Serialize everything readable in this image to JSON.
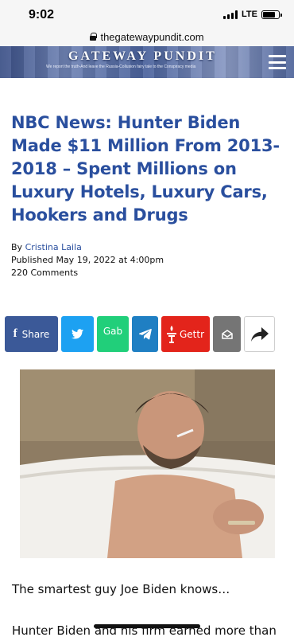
{
  "status_bar": {
    "time": "9:02",
    "network": "LTE"
  },
  "browser": {
    "url": "thegatewaypundit.com"
  },
  "banner": {
    "title": "GATEWAY PUNDIT",
    "tagline": "We report the truth-And leave the Russia-Collusion fairy tale to the Conspiracy media"
  },
  "article": {
    "headline": "NBC News: Hunter Biden Made $11 Million From 2013-2018 – Spent Millions on Luxury Hotels, Luxury Cars, Hookers and Drugs",
    "by_label": "By",
    "author": "Cristina Laila",
    "published": "Published May 19, 2022 at 4:00pm",
    "comments": "220 Comments"
  },
  "share": {
    "facebook_label": "Share",
    "gab_label": "Gab",
    "gettr_label": "Gettr"
  },
  "body": {
    "para1": "The smartest guy Joe Biden knows…",
    "para2": "Hunter Biden and his firm earned more than"
  },
  "colors": {
    "headline": "#2a4f9e",
    "facebook": "#3b5998",
    "twitter": "#1da1f2",
    "gab": "#21cf7a",
    "telegram": "#1f7fc3",
    "gettr": "#e3241b",
    "email": "#757575"
  },
  "icons": [
    "lock-icon",
    "menu-icon",
    "facebook-icon",
    "twitter-icon",
    "telegram-icon",
    "gettr-icon",
    "email-icon",
    "share-arrow-icon"
  ]
}
